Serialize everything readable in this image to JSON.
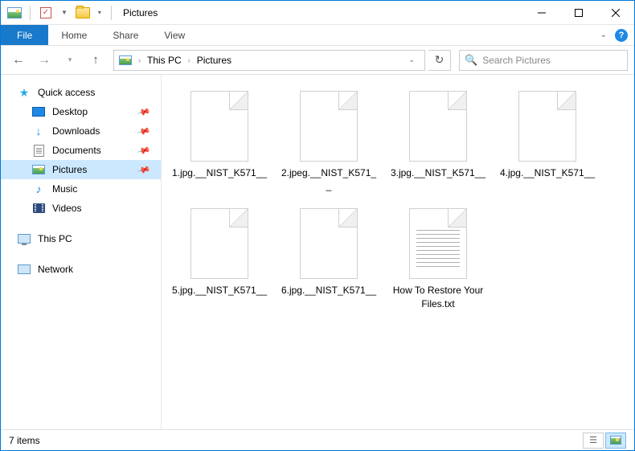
{
  "window": {
    "title": "Pictures"
  },
  "ribbon": {
    "file": "File",
    "tabs": [
      "Home",
      "Share",
      "View"
    ]
  },
  "breadcrumb": {
    "items": [
      "This PC",
      "Pictures"
    ]
  },
  "search": {
    "placeholder": "Search Pictures"
  },
  "sidebar": {
    "quick_access": "Quick access",
    "items": [
      {
        "label": "Desktop",
        "icon": "desktop"
      },
      {
        "label": "Downloads",
        "icon": "downloads"
      },
      {
        "label": "Documents",
        "icon": "documents"
      },
      {
        "label": "Pictures",
        "icon": "pictures",
        "selected": true
      },
      {
        "label": "Music",
        "icon": "music"
      },
      {
        "label": "Videos",
        "icon": "videos"
      }
    ],
    "this_pc": "This PC",
    "network": "Network"
  },
  "files": [
    {
      "name": "1.jpg.__NIST_K571__",
      "type": "blank"
    },
    {
      "name": "2.jpeg.__NIST_K571__",
      "type": "blank"
    },
    {
      "name": "3.jpg.__NIST_K571__",
      "type": "blank"
    },
    {
      "name": "4.jpg.__NIST_K571__",
      "type": "blank"
    },
    {
      "name": "5.jpg.__NIST_K571__",
      "type": "blank"
    },
    {
      "name": "6.jpg.__NIST_K571__",
      "type": "blank"
    },
    {
      "name": "How To Restore Your Files.txt",
      "type": "txt"
    }
  ],
  "status": {
    "count": "7 items"
  }
}
